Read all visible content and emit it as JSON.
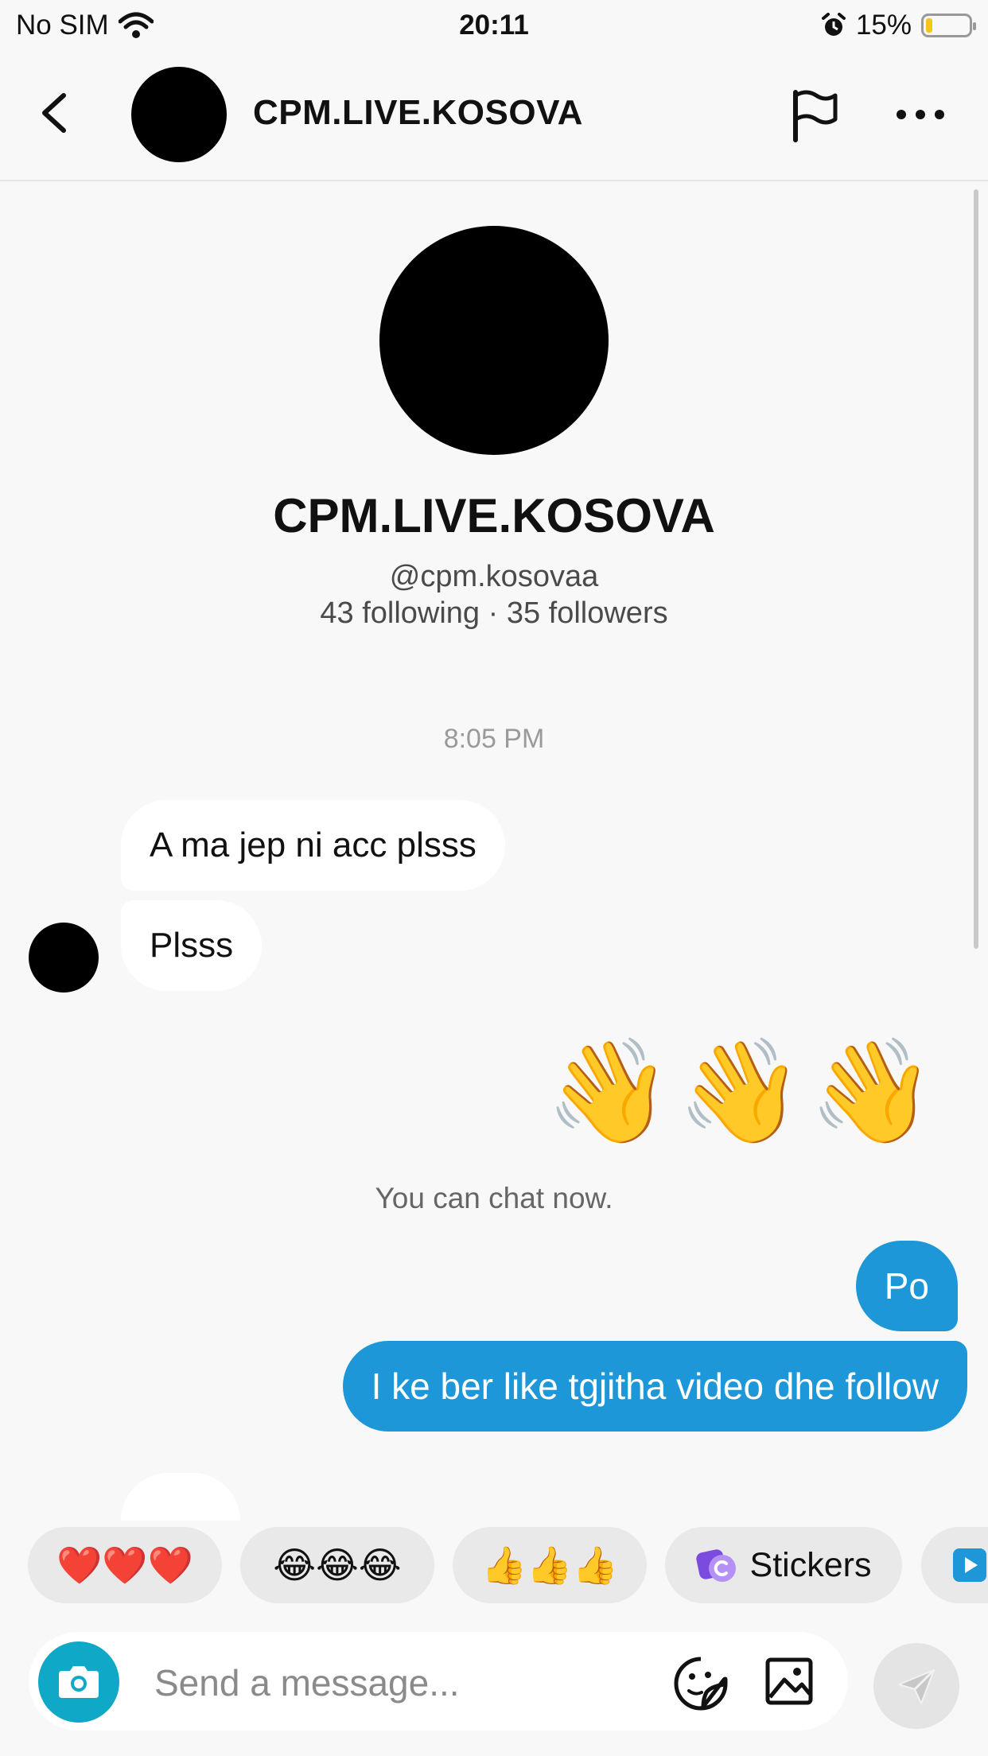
{
  "status_bar": {
    "carrier": "No SIM",
    "time": "20:11",
    "battery": "15%",
    "battery_level": 0.15
  },
  "header": {
    "title": "CPM.LIVE.KOSOVA",
    "icons": [
      "back-icon",
      "flag-icon",
      "more-icon"
    ]
  },
  "profile": {
    "name": "CPM.LIVE.KOSOVA",
    "handle": "@cpm.kosovaa",
    "stats": "43 following · 35 followers"
  },
  "chat": {
    "timestamp": "8:05 PM",
    "incoming": [
      "A ma jep ni acc plsss",
      "Plsss"
    ],
    "wave_emoji": "👋👋👋",
    "system_note": "You can chat now.",
    "outgoing": [
      "Po",
      "I ke ber like tgjitha video dhe follow"
    ]
  },
  "quick_replies": [
    "❤️❤️❤️",
    "😂😂😂",
    "👍👍👍",
    "Stickers"
  ],
  "composer": {
    "placeholder": "Send a message..."
  },
  "colors": {
    "outgoing_bubble": "#1d97d8",
    "camera_button": "#10a8c7",
    "battery": "#f5c518"
  }
}
